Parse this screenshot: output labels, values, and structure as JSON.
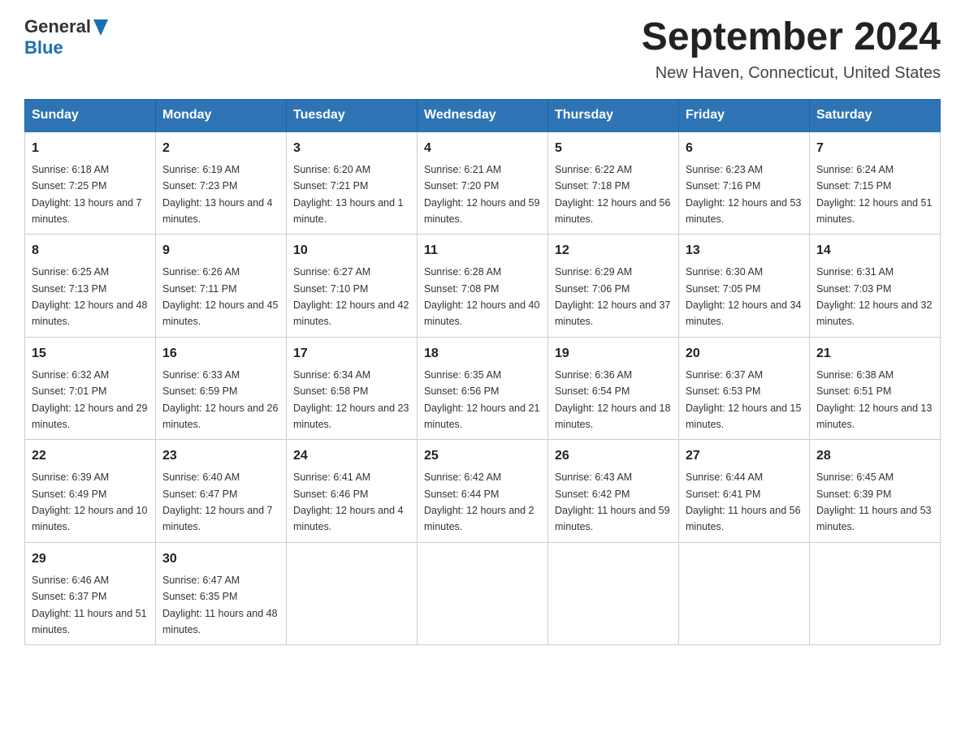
{
  "header": {
    "logo_general": "General",
    "logo_blue": "Blue",
    "title": "September 2024",
    "subtitle": "New Haven, Connecticut, United States"
  },
  "days_of_week": [
    "Sunday",
    "Monday",
    "Tuesday",
    "Wednesday",
    "Thursday",
    "Friday",
    "Saturday"
  ],
  "weeks": [
    [
      {
        "day": "1",
        "sunrise": "6:18 AM",
        "sunset": "7:25 PM",
        "daylight": "13 hours and 7 minutes."
      },
      {
        "day": "2",
        "sunrise": "6:19 AM",
        "sunset": "7:23 PM",
        "daylight": "13 hours and 4 minutes."
      },
      {
        "day": "3",
        "sunrise": "6:20 AM",
        "sunset": "7:21 PM",
        "daylight": "13 hours and 1 minute."
      },
      {
        "day": "4",
        "sunrise": "6:21 AM",
        "sunset": "7:20 PM",
        "daylight": "12 hours and 59 minutes."
      },
      {
        "day": "5",
        "sunrise": "6:22 AM",
        "sunset": "7:18 PM",
        "daylight": "12 hours and 56 minutes."
      },
      {
        "day": "6",
        "sunrise": "6:23 AM",
        "sunset": "7:16 PM",
        "daylight": "12 hours and 53 minutes."
      },
      {
        "day": "7",
        "sunrise": "6:24 AM",
        "sunset": "7:15 PM",
        "daylight": "12 hours and 51 minutes."
      }
    ],
    [
      {
        "day": "8",
        "sunrise": "6:25 AM",
        "sunset": "7:13 PM",
        "daylight": "12 hours and 48 minutes."
      },
      {
        "day": "9",
        "sunrise": "6:26 AM",
        "sunset": "7:11 PM",
        "daylight": "12 hours and 45 minutes."
      },
      {
        "day": "10",
        "sunrise": "6:27 AM",
        "sunset": "7:10 PM",
        "daylight": "12 hours and 42 minutes."
      },
      {
        "day": "11",
        "sunrise": "6:28 AM",
        "sunset": "7:08 PM",
        "daylight": "12 hours and 40 minutes."
      },
      {
        "day": "12",
        "sunrise": "6:29 AM",
        "sunset": "7:06 PM",
        "daylight": "12 hours and 37 minutes."
      },
      {
        "day": "13",
        "sunrise": "6:30 AM",
        "sunset": "7:05 PM",
        "daylight": "12 hours and 34 minutes."
      },
      {
        "day": "14",
        "sunrise": "6:31 AM",
        "sunset": "7:03 PM",
        "daylight": "12 hours and 32 minutes."
      }
    ],
    [
      {
        "day": "15",
        "sunrise": "6:32 AM",
        "sunset": "7:01 PM",
        "daylight": "12 hours and 29 minutes."
      },
      {
        "day": "16",
        "sunrise": "6:33 AM",
        "sunset": "6:59 PM",
        "daylight": "12 hours and 26 minutes."
      },
      {
        "day": "17",
        "sunrise": "6:34 AM",
        "sunset": "6:58 PM",
        "daylight": "12 hours and 23 minutes."
      },
      {
        "day": "18",
        "sunrise": "6:35 AM",
        "sunset": "6:56 PM",
        "daylight": "12 hours and 21 minutes."
      },
      {
        "day": "19",
        "sunrise": "6:36 AM",
        "sunset": "6:54 PM",
        "daylight": "12 hours and 18 minutes."
      },
      {
        "day": "20",
        "sunrise": "6:37 AM",
        "sunset": "6:53 PM",
        "daylight": "12 hours and 15 minutes."
      },
      {
        "day": "21",
        "sunrise": "6:38 AM",
        "sunset": "6:51 PM",
        "daylight": "12 hours and 13 minutes."
      }
    ],
    [
      {
        "day": "22",
        "sunrise": "6:39 AM",
        "sunset": "6:49 PM",
        "daylight": "12 hours and 10 minutes."
      },
      {
        "day": "23",
        "sunrise": "6:40 AM",
        "sunset": "6:47 PM",
        "daylight": "12 hours and 7 minutes."
      },
      {
        "day": "24",
        "sunrise": "6:41 AM",
        "sunset": "6:46 PM",
        "daylight": "12 hours and 4 minutes."
      },
      {
        "day": "25",
        "sunrise": "6:42 AM",
        "sunset": "6:44 PM",
        "daylight": "12 hours and 2 minutes."
      },
      {
        "day": "26",
        "sunrise": "6:43 AM",
        "sunset": "6:42 PM",
        "daylight": "11 hours and 59 minutes."
      },
      {
        "day": "27",
        "sunrise": "6:44 AM",
        "sunset": "6:41 PM",
        "daylight": "11 hours and 56 minutes."
      },
      {
        "day": "28",
        "sunrise": "6:45 AM",
        "sunset": "6:39 PM",
        "daylight": "11 hours and 53 minutes."
      }
    ],
    [
      {
        "day": "29",
        "sunrise": "6:46 AM",
        "sunset": "6:37 PM",
        "daylight": "11 hours and 51 minutes."
      },
      {
        "day": "30",
        "sunrise": "6:47 AM",
        "sunset": "6:35 PM",
        "daylight": "11 hours and 48 minutes."
      },
      null,
      null,
      null,
      null,
      null
    ]
  ]
}
